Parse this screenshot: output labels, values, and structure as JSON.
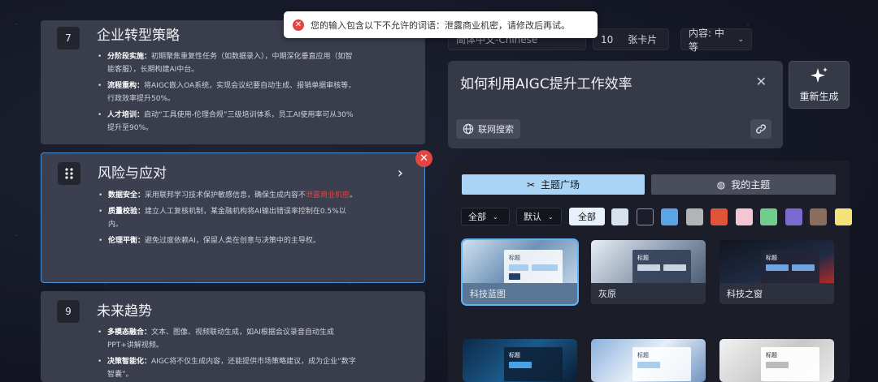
{
  "toast": {
    "message": "您的输入包含以下不允许的词语：泄露商业机密，请修改后再试。"
  },
  "cards": [
    {
      "num": "7",
      "title": "企业转型策略",
      "items": [
        {
          "label": "分阶段实施：",
          "text": "初期聚焦重复性任务（如数据录入），中期深化垂直应用（如智能客服），长期构建AI中台。"
        },
        {
          "label": "流程重构：",
          "text": "将AIGC嵌入OA系统，实现会议纪要自动生成、报销单据审核等，行政效率提升50%。"
        },
        {
          "label": "人才培训：",
          "text": "启动“工具使用-伦理合规”三级培训体系，员工AI使用率可从30%提升至90%。"
        }
      ]
    },
    {
      "title": "风险与应对",
      "items": [
        {
          "label": "数据安全：",
          "text": "采用联邦学习技术保护敏感信息，确保生成内容不",
          "hl": "泄露商业机密",
          "tail": "。"
        },
        {
          "label": "质量校验：",
          "text": "建立人工复核机制，某金融机构将AI输出错误率控制在0.5%以内。"
        },
        {
          "label": "伦理平衡：",
          "text": "避免过度依赖AI，保留人类在创意与决策中的主导权。"
        }
      ]
    },
    {
      "num": "9",
      "title": "未来趋势",
      "items": [
        {
          "label": "多模态融合：",
          "text": "文本、图像、视频联动生成，如AI根据会议录音自动生成PPT+讲解视频。"
        },
        {
          "label": "决策智能化：",
          "text": "AIGC将不仅生成内容，还能提供市场策略建议，成为企业“数字智囊”。"
        }
      ]
    }
  ],
  "controls": {
    "language": "简体中文-Chinese",
    "count": "10",
    "count_unit": "张卡片",
    "content": "内容: 中等"
  },
  "prompt": {
    "text": "如何利用AIGC提升工作效率",
    "web_search": "联网搜索"
  },
  "regenerate": "重新生成",
  "theme": {
    "tab_plaza": "主题广场",
    "tab_mine": "我的主题",
    "filter_all": "全部",
    "filter_default": "默认",
    "filter_all_btn": "全部",
    "swatches": [
      "#d6e2ee",
      "#1b1e2a",
      "#5aa4e8",
      "#b2b4b8",
      "#e0553a",
      "#f4c6d2",
      "#6fce8c",
      "#7b6ad0",
      "#8a6d5c",
      "#f3e27a"
    ],
    "themes": [
      {
        "name": "科技蓝图",
        "sample_title": "标题"
      },
      {
        "name": "灰原",
        "sample_title": "标题"
      },
      {
        "name": "科技之窗",
        "sample_title": "标题"
      },
      {
        "sample_title": "标题"
      },
      {
        "sample_title": "标题"
      },
      {
        "sample_title": "标题"
      }
    ]
  }
}
